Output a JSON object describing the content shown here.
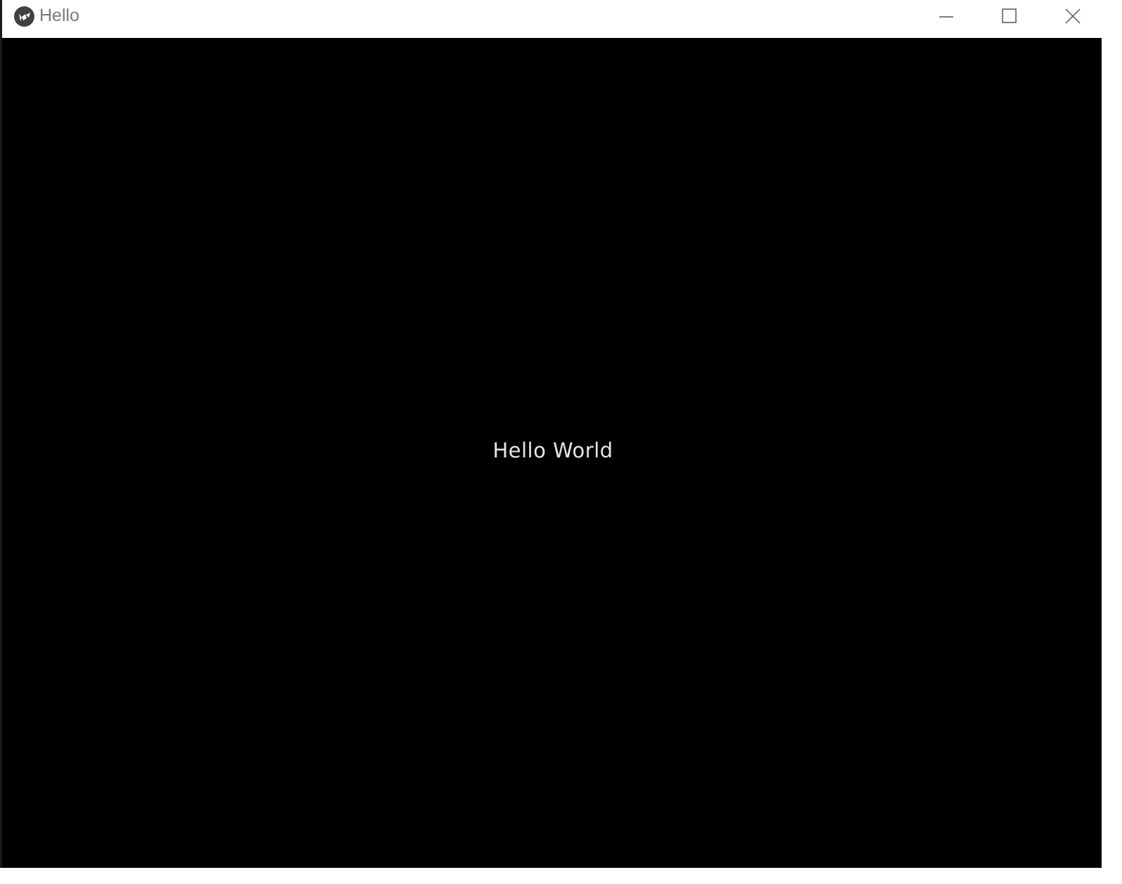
{
  "window": {
    "title": "Hello",
    "app_icon": "kivy-logo-icon",
    "controls": {
      "minimize_icon": "minimize-icon",
      "maximize_icon": "maximize-icon",
      "close_icon": "close-icon"
    }
  },
  "content": {
    "label": "Hello World",
    "background": "#000000",
    "text_color": "#e6e6e6"
  }
}
